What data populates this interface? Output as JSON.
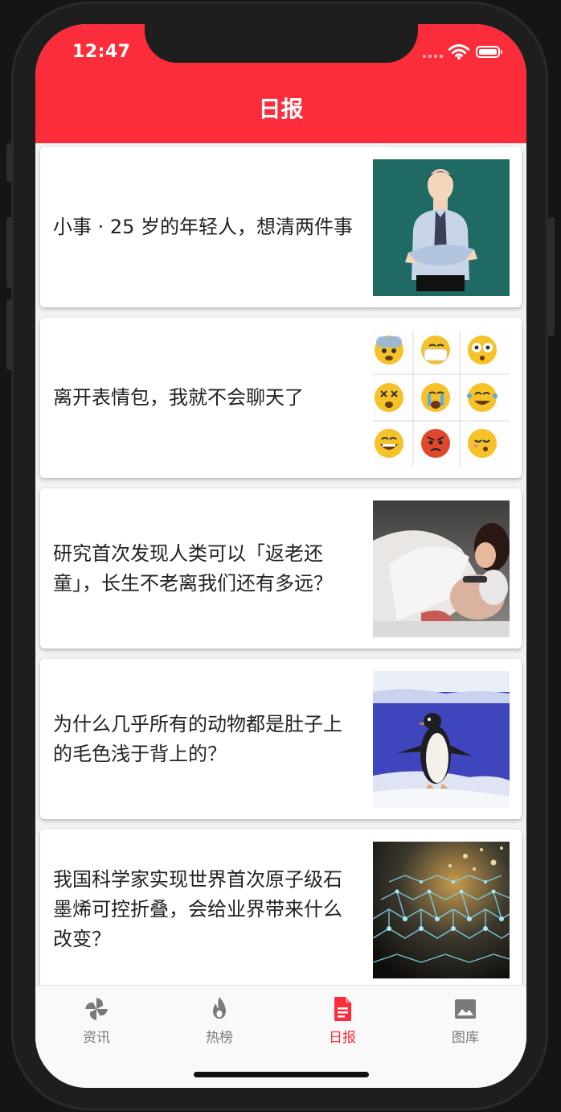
{
  "status_bar": {
    "time": "12:47"
  },
  "nav": {
    "title": "日报"
  },
  "articles": [
    {
      "title": "小事 · 25 岁的年轻人，想清两件事",
      "thumb": "man-in-shirt-illustration"
    },
    {
      "title": "离开表情包，我就不会聊天了",
      "thumb": "emoji-grid"
    },
    {
      "title": "研究首次发现人类可以「返老还童」，长生不老离我们还有多远？",
      "thumb": "elderly-man-and-woman-photo"
    },
    {
      "title": "为什么几乎所有的动物都是肚子上的毛色浅于背上的？",
      "thumb": "penguin-photo"
    },
    {
      "title": "我国科学家实现世界首次原子级石墨烯可控折叠，会给业界带来什么改变？",
      "thumb": "graphene-lattice-image"
    }
  ],
  "tabs": [
    {
      "label": "资讯",
      "icon": "pinwheel-icon",
      "active": false
    },
    {
      "label": "热榜",
      "icon": "flame-icon",
      "active": false
    },
    {
      "label": "日报",
      "icon": "document-icon",
      "active": true
    },
    {
      "label": "图库",
      "icon": "image-icon",
      "active": false
    }
  ],
  "colors": {
    "accent": "#fb2d3a",
    "tab_inactive": "#7a7a7a",
    "background": "#f2f2f2"
  }
}
